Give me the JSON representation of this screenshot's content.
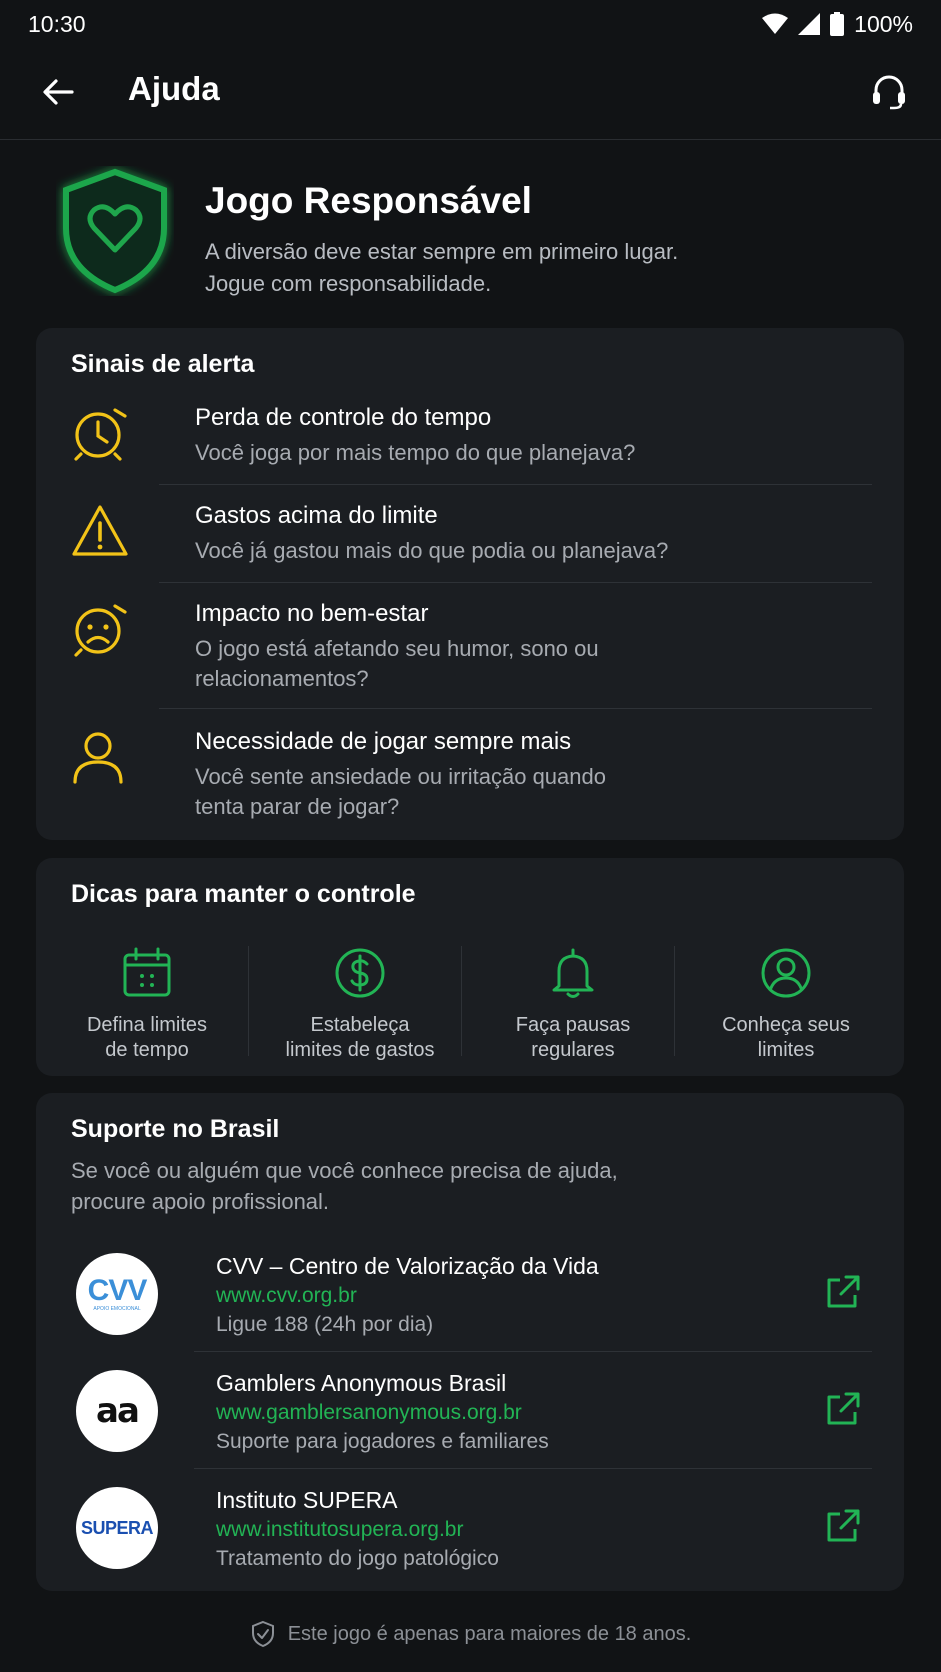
{
  "status_bar": {
    "time": "10:30",
    "battery": "100%"
  },
  "app_bar": {
    "title": "Ajuda"
  },
  "hero": {
    "title": "Jogo Responsável",
    "subtitle_line1": "A diversão deve estar sempre em primeiro lugar.",
    "subtitle_line2": "Jogue com responsabilidade."
  },
  "alerts": {
    "title": "Sinais de alerta",
    "items": [
      {
        "icon": "alarm-clock-icon",
        "title": "Perda de controle do tempo",
        "desc_line1": "Você joga por mais tempo do que planejava?",
        "desc_line2": ""
      },
      {
        "icon": "warning-icon",
        "title": "Gastos acima do limite",
        "desc_line1": "Você já gastou mais do que podia ou planejava?",
        "desc_line2": ""
      },
      {
        "icon": "sad-face-icon",
        "title": "Impacto no bem-estar",
        "desc_line1": "O jogo está afetando seu humor, sono ou",
        "desc_line2": "relacionamentos?"
      },
      {
        "icon": "person-icon",
        "title": "Necessidade de jogar sempre mais",
        "desc_line1": "Você sente ansiedade ou irritação quando",
        "desc_line2": "tenta parar de jogar?"
      }
    ]
  },
  "tips": {
    "title": "Dicas para manter o controle",
    "items": [
      {
        "icon": "calendar-icon",
        "line1": "Defina limites",
        "line2": "de tempo"
      },
      {
        "icon": "dollar-icon",
        "line1": "Estabeleça",
        "line2": "limites de gastos"
      },
      {
        "icon": "bell-icon",
        "line1": "Faça pausas",
        "line2": "regulares"
      },
      {
        "icon": "user-circle-icon",
        "line1": "Conheça seus",
        "line2": "limites"
      }
    ]
  },
  "support": {
    "title": "Suporte no Brasil",
    "desc_line1": "Se você ou alguém que você conhece precisa de ajuda,",
    "desc_line2": "procure apoio profissional.",
    "orgs": [
      {
        "logo_text": "CVV",
        "logo_sub": "APOIO EMOCIONAL",
        "name": "CVV – Centro de Valorização da Vida",
        "url": "www.cvv.org.br",
        "note": "Ligue 188 (24h por dia)"
      },
      {
        "logo_text": "aa",
        "name": "Gamblers Anonymous Brasil",
        "url": "www.gamblersanonymous.org.br",
        "note": "Suporte para jogadores e familiares"
      },
      {
        "logo_text": "SUPERA",
        "name": "Instituto SUPERA",
        "url": "www.institutosupera.org.br",
        "note": "Tratamento do jogo patológico"
      }
    ]
  },
  "footer": {
    "text": "Este jogo é apenas para maiores de 18 anos."
  },
  "colors": {
    "accent_green": "#22b455",
    "warning_yellow": "#f2c318",
    "background": "#111315",
    "card": "#1b1e22"
  }
}
